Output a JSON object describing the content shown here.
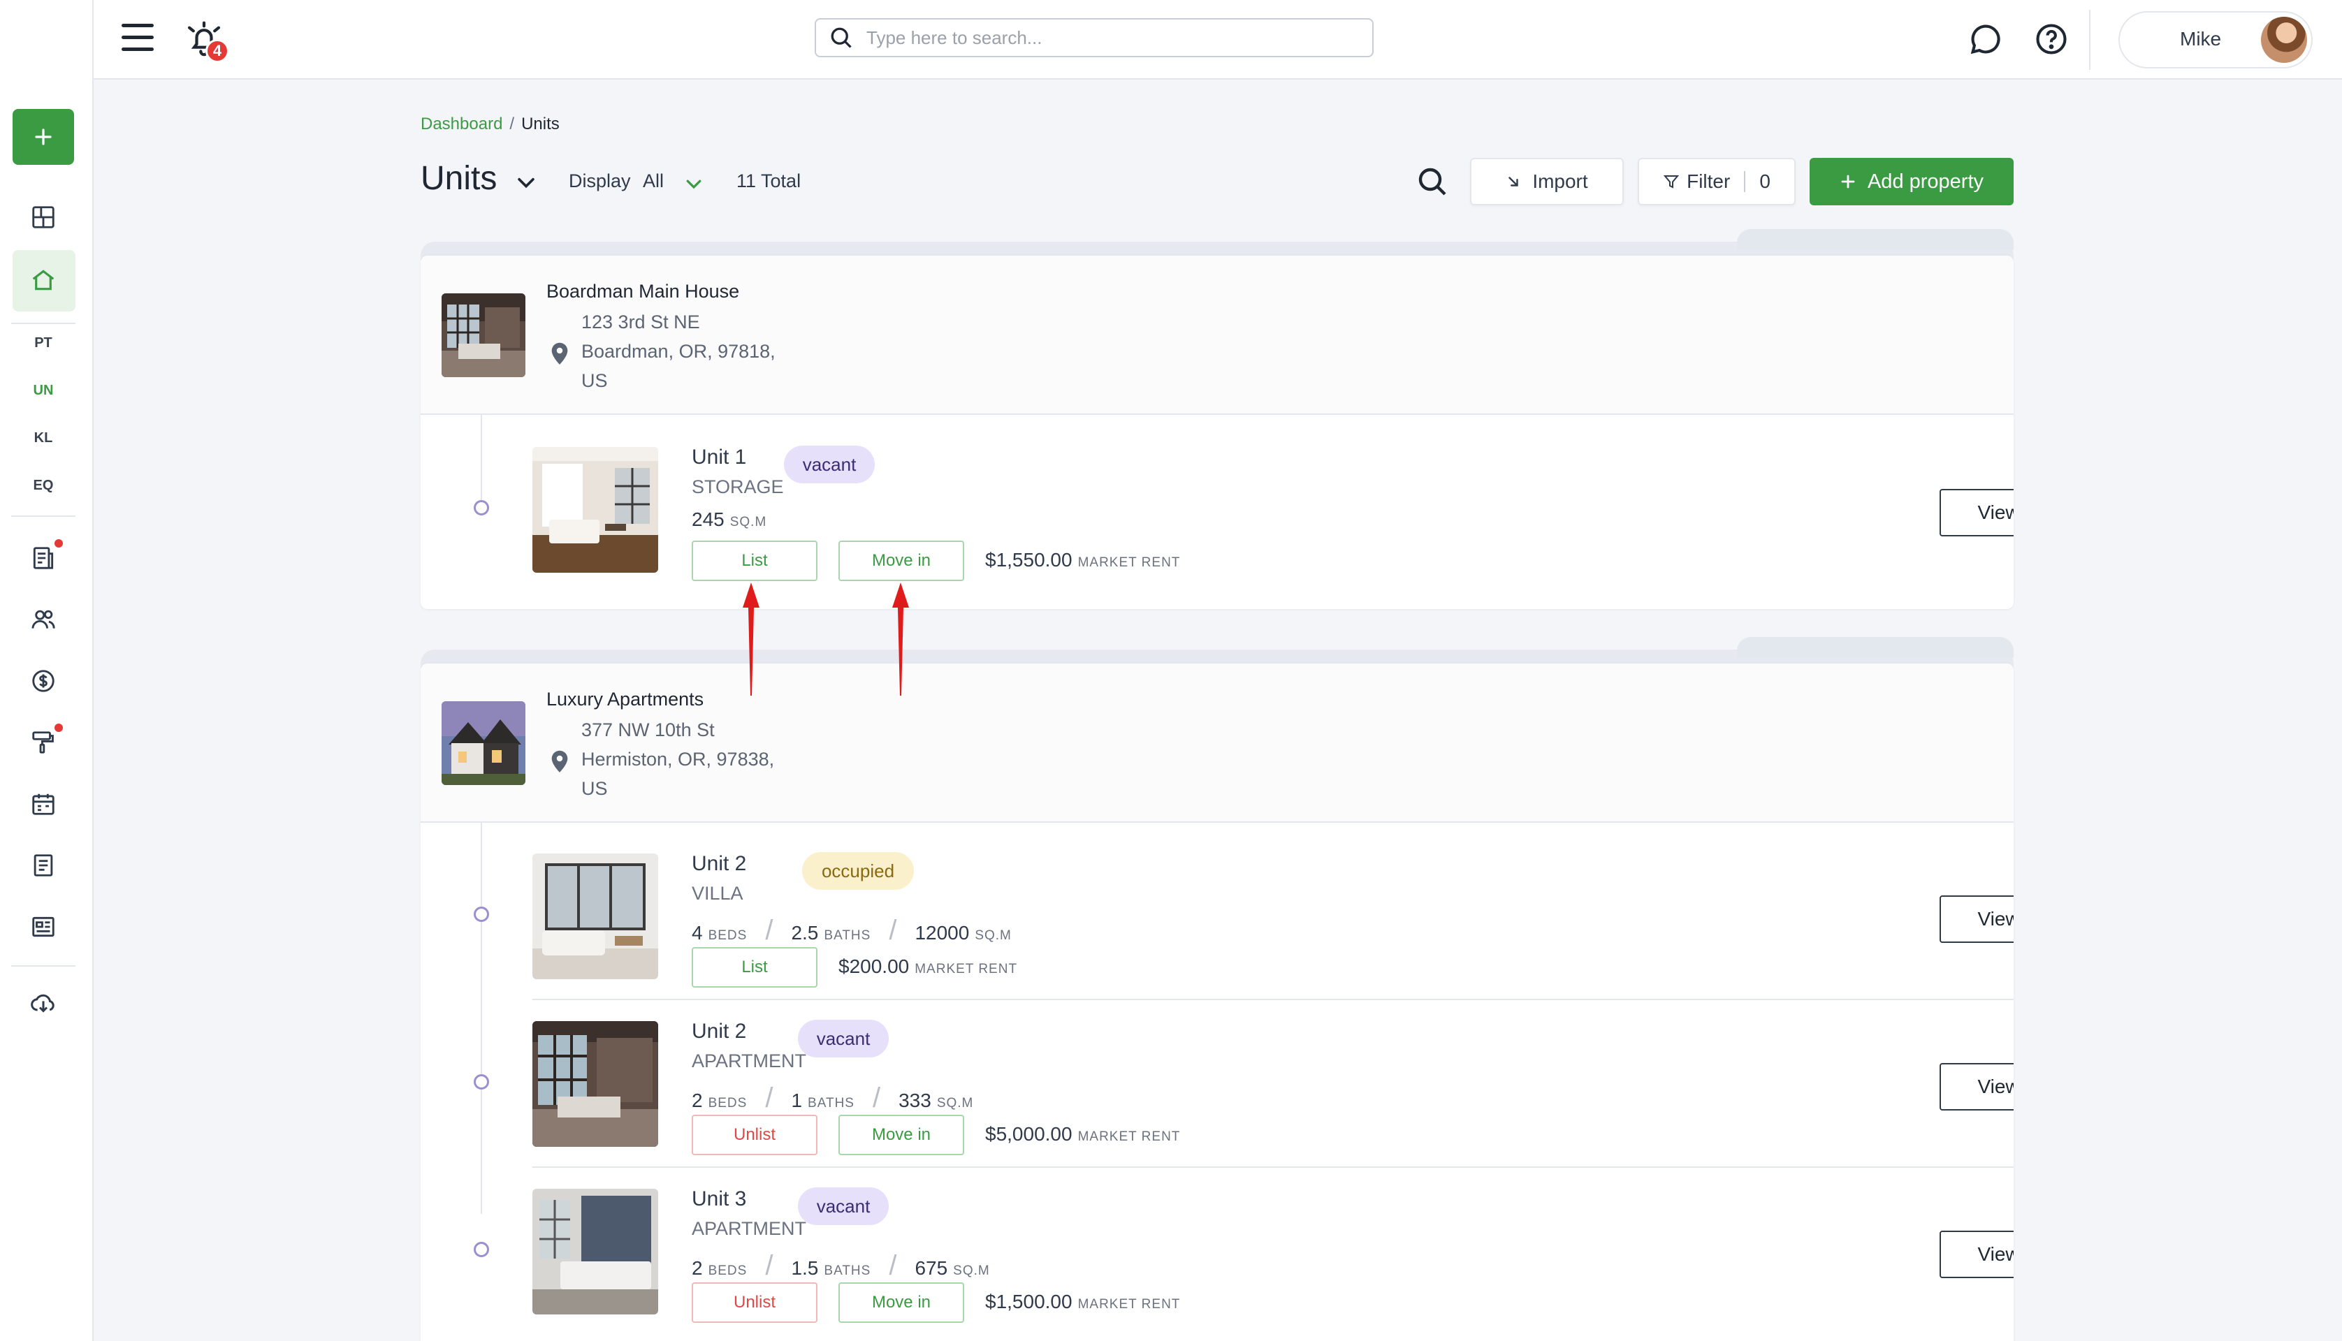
{
  "header": {
    "notification_count": "4",
    "search_placeholder": "Type here to search...",
    "user_name": "Mike"
  },
  "sidebar": {
    "short_items": [
      "PT",
      "UN",
      "KL",
      "EQ"
    ],
    "active_item": "UN",
    "icons": [
      "grid-icon",
      "home-icon",
      "report-icon",
      "people-icon",
      "dollar-icon",
      "paint-roller-icon",
      "calendar-icon",
      "document-icon",
      "news-icon",
      "cloud-download-icon"
    ]
  },
  "breadcrumb": {
    "root": "Dashboard",
    "separator": "/",
    "current": "Units"
  },
  "toolbar": {
    "title": "Units",
    "display_label": "Display",
    "display_value": "All",
    "total": "11 Total",
    "import_label": "Import",
    "filter_label": "Filter",
    "filter_count": "0",
    "add_label": "Add property"
  },
  "colors": {
    "accent": "#3a9b42",
    "vacant_bg": "#e7e0fb",
    "occupied_bg": "#fbf0cc",
    "unlist": "#e04848"
  },
  "properties": [
    {
      "name": "Boardman Main House",
      "address_line1": "123 3rd St NE",
      "address_line2": "Boardman, OR, 97818,",
      "address_line3": "US",
      "units": [
        {
          "name": "Unit 1",
          "status": "vacant",
          "type": "STORAGE",
          "sqm": "245",
          "sqm_unit": "SQ.M",
          "list_label": "List",
          "move_in_label": "Move in",
          "rent": "$1,550.00",
          "rent_unit": "MARKET RENT",
          "view_label": "View unit"
        }
      ]
    },
    {
      "name": "Luxury Apartments",
      "address_line1": "377 NW 10th St",
      "address_line2": "Hermiston, OR, 97838,",
      "address_line3": "US",
      "units": [
        {
          "name": "Unit 2",
          "status": "occupied",
          "type": "VILLA",
          "beds": "4",
          "beds_unit": "BEDS",
          "baths": "2.5",
          "baths_unit": "BATHS",
          "sqm": "12000",
          "sqm_unit": "SQ.M",
          "list_label": "List",
          "rent": "$200.00",
          "rent_unit": "MARKET RENT",
          "view_label": "View unit"
        },
        {
          "name": "Unit 2",
          "status": "vacant",
          "type": "APARTMENT",
          "beds": "2",
          "beds_unit": "BEDS",
          "baths": "1",
          "baths_unit": "BATHS",
          "sqm": "333",
          "sqm_unit": "SQ.M",
          "unlist_label": "Unlist",
          "move_in_label": "Move in",
          "rent": "$5,000.00",
          "rent_unit": "MARKET RENT",
          "view_label": "View unit"
        },
        {
          "name": "Unit 3",
          "status": "vacant",
          "type": "APARTMENT",
          "beds": "2",
          "beds_unit": "BEDS",
          "baths": "1.5",
          "baths_unit": "BATHS",
          "sqm": "675",
          "sqm_unit": "SQ.M",
          "unlist_label": "Unlist",
          "move_in_label": "Move in",
          "rent": "$1,500.00",
          "rent_unit": "MARKET RENT",
          "view_label": "View unit"
        }
      ]
    }
  ]
}
